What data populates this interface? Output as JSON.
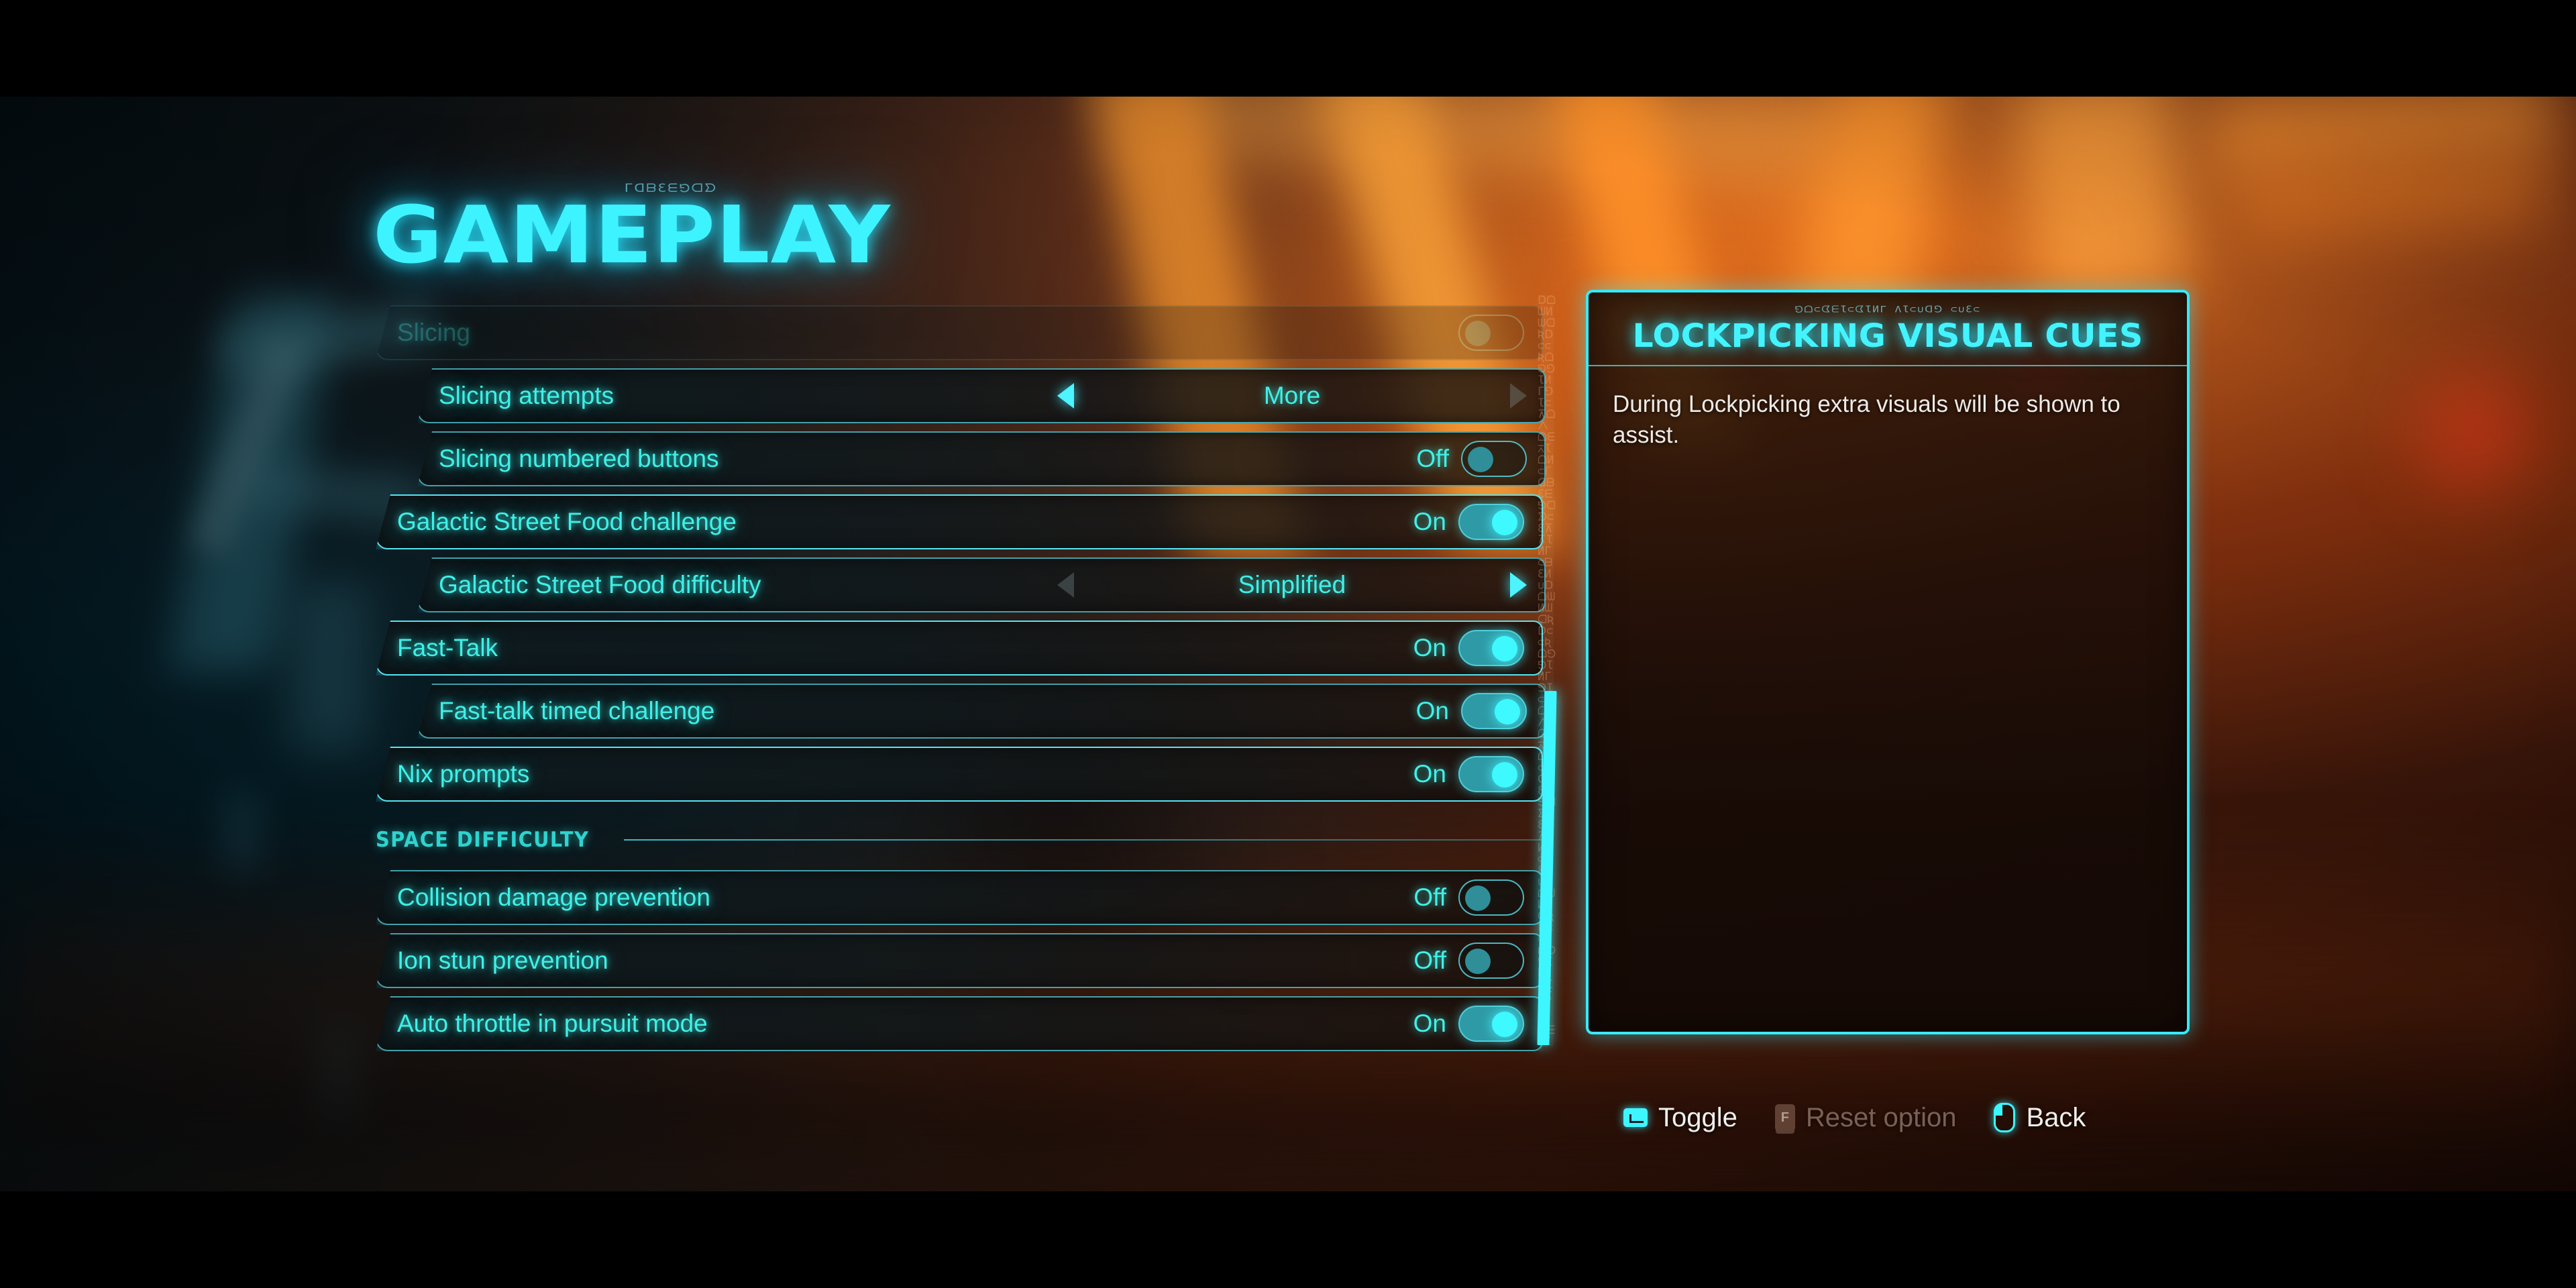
{
  "page": {
    "title": "GAMEPLAY",
    "title_aurebesh": "GAMEPLAY"
  },
  "settings": {
    "rows": [
      {
        "id": "slicing",
        "label": "Slicing",
        "kind": "toggle",
        "state": "",
        "indent": false,
        "faded": true,
        "selected": false
      },
      {
        "id": "slicing-attempts",
        "label": "Slicing attempts",
        "kind": "stepper",
        "value": "More",
        "left_arrow_enabled": true,
        "right_arrow_enabled": false,
        "indent": true,
        "faded": false,
        "selected": false
      },
      {
        "id": "slicing-numbered-buttons",
        "label": "Slicing numbered buttons",
        "kind": "toggle",
        "state": "Off",
        "indent": true,
        "faded": false,
        "selected": false
      },
      {
        "id": "galactic-street-food-challenge",
        "label": "Galactic Street Food challenge",
        "kind": "toggle",
        "state": "On",
        "indent": false,
        "faded": false,
        "selected": true
      },
      {
        "id": "galactic-street-food-difficulty",
        "label": "Galactic Street Food difficulty",
        "kind": "stepper",
        "value": "Simplified",
        "left_arrow_enabled": false,
        "right_arrow_enabled": true,
        "indent": true,
        "faded": false,
        "selected": false
      },
      {
        "id": "fast-talk",
        "label": "Fast-Talk",
        "kind": "toggle",
        "state": "On",
        "indent": false,
        "faded": false,
        "selected": true
      },
      {
        "id": "fast-talk-timed-challenge",
        "label": "Fast-talk timed challenge",
        "kind": "toggle",
        "state": "On",
        "indent": true,
        "faded": false,
        "selected": false
      },
      {
        "id": "nix-prompts",
        "label": "Nix prompts",
        "kind": "toggle",
        "state": "On",
        "indent": false,
        "faded": false,
        "selected": true
      },
      {
        "id": "space-difficulty-header",
        "label": "SPACE DIFFICULTY",
        "kind": "section",
        "indent": false,
        "faded": false,
        "selected": false
      },
      {
        "id": "collision-damage-prevention",
        "label": "Collision damage prevention",
        "kind": "toggle",
        "state": "Off",
        "indent": false,
        "faded": false,
        "selected": false
      },
      {
        "id": "ion-stun-prevention",
        "label": "Ion stun prevention",
        "kind": "toggle",
        "state": "Off",
        "indent": false,
        "faded": false,
        "selected": false
      },
      {
        "id": "auto-throttle-in-pursuit-mode",
        "label": "Auto throttle in pursuit mode",
        "kind": "toggle",
        "state": "On",
        "indent": false,
        "faded": false,
        "selected": false
      }
    ]
  },
  "scrollbar": {
    "aurebesh_track": "DOWNWARDSCROLLINGLISTOFOPTIONSGAMEPLAYSETTINGSMENU"
  },
  "info_panel": {
    "aurebesh": "LOCKPICKING VISUAL CUES",
    "title": "LOCKPICKING VISUAL CUES",
    "body": "During Lockpicking extra visuals will be shown to assist."
  },
  "prompts": [
    {
      "id": "toggle",
      "label": "Toggle",
      "icon": "enter-key-icon",
      "enabled": true
    },
    {
      "id": "reset-option",
      "label": "Reset option",
      "icon": "f-key-icon",
      "enabled": false
    },
    {
      "id": "back",
      "label": "Back",
      "icon": "mouse-icon",
      "enabled": true
    }
  ],
  "colors": {
    "accent_cyan": "#3df6ff",
    "row_text": "#3ff0e8",
    "section_header": "#2fd3cf",
    "panel_border": "#37eaf8",
    "body_text": "#efeae6",
    "disabled_prompt": "#9b8073"
  }
}
